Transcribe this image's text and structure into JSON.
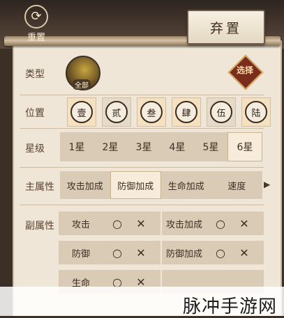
{
  "header": {
    "reset_label": "重置",
    "discard_label": "弃置"
  },
  "type": {
    "label": "类型",
    "avatar_caption": "全部",
    "select_label": "选择"
  },
  "position": {
    "label": "位置",
    "items": [
      "壹",
      "贰",
      "叁",
      "肆",
      "伍",
      "陆"
    ],
    "selected": [
      0,
      2,
      3,
      5
    ]
  },
  "star": {
    "label": "星级",
    "items": [
      "1星",
      "2星",
      "3星",
      "4星",
      "5星",
      "6星"
    ],
    "selected": 5
  },
  "main_attr": {
    "label": "主属性",
    "items": [
      "攻击加成",
      "防御加成",
      "生命加成",
      "速度"
    ],
    "selected": 1
  },
  "sub_attr": {
    "label": "副属性",
    "ok_symbol": "○",
    "no_symbol": "✕",
    "items": [
      "攻击",
      "攻击加成",
      "防御",
      "防御加成",
      "生命",
      ""
    ]
  },
  "watermark": "脉冲手游网"
}
